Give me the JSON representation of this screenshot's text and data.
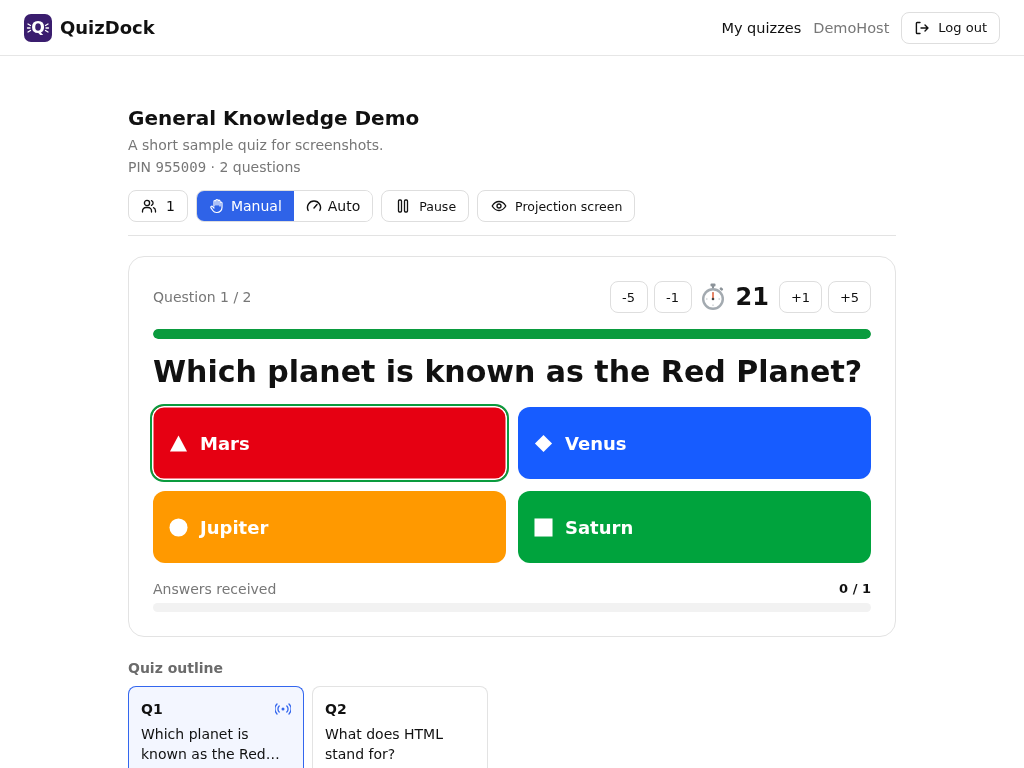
{
  "header": {
    "logo_letter": "Q",
    "brand": "QuizDock",
    "nav_link": "My quizzes",
    "user": "DemoHost",
    "logout_button": "Log out"
  },
  "quiz": {
    "title": "General Knowledge Demo",
    "description": "A short sample quiz for screenshots.",
    "pin_label": "PIN",
    "pin": "955009",
    "meta": "· 2 questions"
  },
  "toolbar": {
    "participants": "1",
    "modes": [
      {
        "label": "Manual",
        "kind": "manual",
        "selected": true
      },
      {
        "label": "Auto",
        "kind": "auto",
        "selected": false
      }
    ],
    "pause_button": "Pause",
    "projection_button": "Projection screen"
  },
  "question": {
    "counter": "Question 1 / 2",
    "time_minus": [
      "-5",
      "-1"
    ],
    "remaining": "21",
    "time_plus": [
      "+1",
      "+5"
    ],
    "time_bar": {
      "level": 1
    },
    "text": "Which planet is known as the Red Planet?",
    "answers": [
      {
        "label": "Mars",
        "kind": "triangle",
        "color": "#e60012",
        "highlighted": true
      },
      {
        "label": "Venus",
        "kind": "diamond",
        "color": "#175cff",
        "highlighted": false
      },
      {
        "label": "Jupiter",
        "kind": "circle",
        "color": "#ff9900",
        "highlighted": false
      },
      {
        "label": "Saturn",
        "kind": "square",
        "color": "#00a33d",
        "highlighted": false
      }
    ],
    "answers_received_label": "Answers received",
    "answers_received": "0 / 1"
  },
  "outline": {
    "title": "Quiz outline",
    "items": [
      {
        "number": "Q1",
        "text": "Which planet is known as the Red…",
        "selected": true,
        "live": true
      },
      {
        "number": "Q2",
        "text": "What does HTML stand for?",
        "selected": false,
        "live": false
      }
    ]
  }
}
